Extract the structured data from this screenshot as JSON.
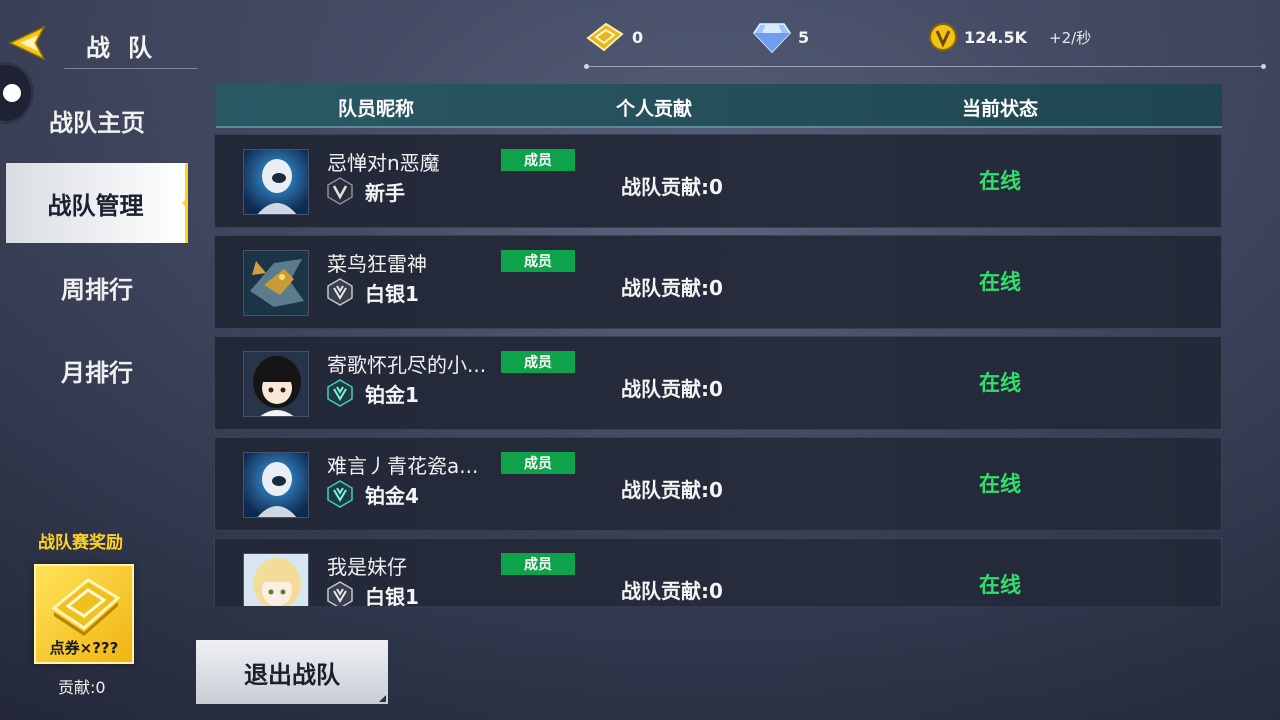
{
  "header": {
    "title": "战队",
    "back_icon": "back-arrow-icon"
  },
  "resources": {
    "coupon": {
      "icon": "coupon-icon",
      "value": "0"
    },
    "diamond": {
      "icon": "diamond-icon",
      "value": "5"
    },
    "coin": {
      "icon": "coin-icon",
      "value": "124.5K",
      "rate": "+2/秒"
    }
  },
  "nav": {
    "items": [
      {
        "label": "战队主页",
        "active": false
      },
      {
        "label": "战队管理",
        "active": true
      },
      {
        "label": "周排行",
        "active": false
      },
      {
        "label": "月排行",
        "active": false
      }
    ]
  },
  "reward": {
    "title": "战队赛奖励",
    "card_label": "点券×???",
    "contribution": "贡献:0"
  },
  "table": {
    "columns": [
      "队员昵称",
      "个人贡献",
      "当前状态"
    ],
    "rows": [
      {
        "name": "忌惮对n恶魔",
        "role": "成员",
        "rank": "新手",
        "contribution": "战队贡献:0",
        "status": "在线",
        "avatar": "robot-avatar"
      },
      {
        "name": "菜鸟狂雷神",
        "role": "成员",
        "rank": "白银1",
        "contribution": "战队贡献:0",
        "status": "在线",
        "avatar": "dragon-avatar"
      },
      {
        "name": "寄歌怀孔尽的小...",
        "role": "成员",
        "rank": "铂金1",
        "contribution": "战队贡献:0",
        "status": "在线",
        "avatar": "anime-girl-avatar"
      },
      {
        "name": "难言丿青花瓷a...",
        "role": "成员",
        "rank": "铂金4",
        "contribution": "战队贡献:0",
        "status": "在线",
        "avatar": "robot-avatar"
      },
      {
        "name": "我是妹仔",
        "role": "成员",
        "rank": "白银1",
        "contribution": "战队贡献:0",
        "status": "在线",
        "avatar": "blonde-girl-avatar"
      }
    ]
  },
  "actions": {
    "quit_label": "退出战队"
  },
  "colors": {
    "accent_yellow": "#ffd21e",
    "online_green": "#2fe06b",
    "badge_green": "#0ea34a",
    "header_teal": "#2a5964"
  }
}
